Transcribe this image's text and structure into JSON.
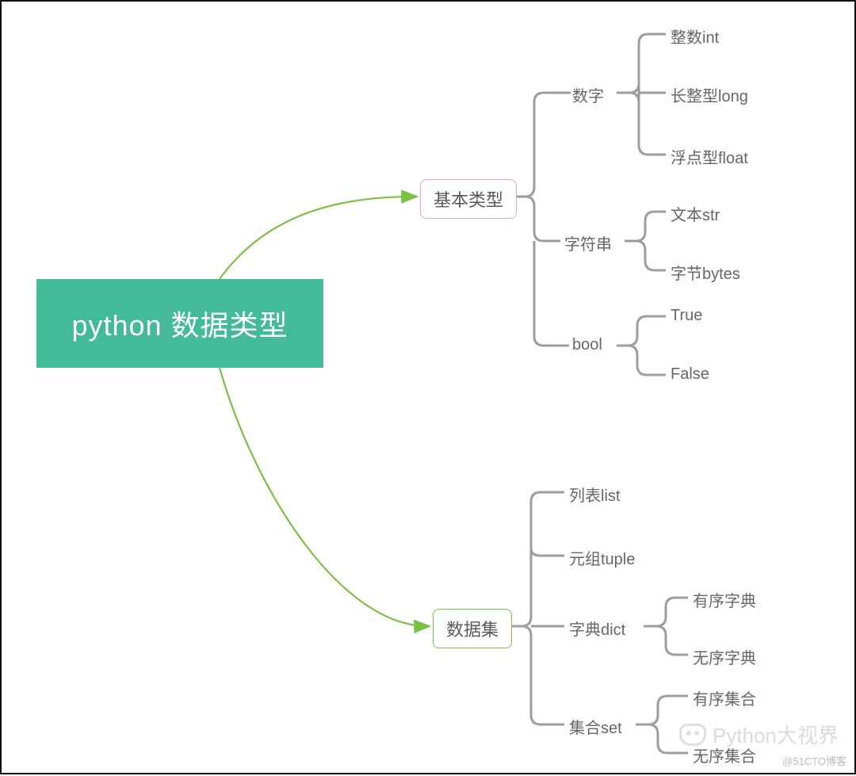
{
  "root": {
    "label": "python 数据类型"
  },
  "branches": {
    "basic": {
      "label": "基本类型",
      "children": {
        "number": {
          "label": "数字",
          "items": [
            "整数int",
            "长整型long",
            "浮点型float"
          ]
        },
        "string": {
          "label": "字符串",
          "items": [
            "文本str",
            "字节bytes"
          ]
        },
        "bool": {
          "label": "bool",
          "items": [
            "True",
            "False"
          ]
        }
      }
    },
    "dataset": {
      "label": "数据集",
      "children": {
        "list": {
          "label": "列表list"
        },
        "tuple": {
          "label": "元组tuple"
        },
        "dict": {
          "label": "字典dict",
          "items": [
            "有序字典",
            "无序字典"
          ]
        },
        "set": {
          "label": "集合set",
          "items": [
            "有序集合",
            "无序集合"
          ]
        }
      }
    }
  },
  "watermark": "Python大视界",
  "attribution": "@51CTO博客",
  "colors": {
    "root_bg": "#44bb97",
    "arrow_green": "#7bc143",
    "bracket_gray": "#9e9e9e",
    "text_gray": "#666666",
    "basic_border": "#f2a6a6"
  }
}
